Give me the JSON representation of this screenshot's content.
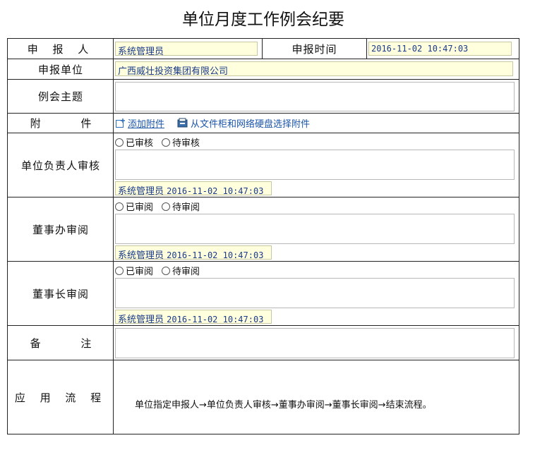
{
  "title": "单位月度工作例会纪要",
  "labels": {
    "reporter": "申 报 人",
    "report_time": "申报时间",
    "report_unit": "申报单位",
    "meeting_topic": "例会主题",
    "attachment": "附 件",
    "unit_head_review": "单位负责人审核",
    "board_office_review": "董事办审阅",
    "chairman_review": "董事长审阅",
    "remarks": "备 注",
    "workflow": "应 用 流 程"
  },
  "values": {
    "reporter": "系统管理员",
    "report_time": "2016-11-02 10:47:03",
    "report_unit": "广西威壮投资集团有限公司"
  },
  "attachment": {
    "add_label": "添加附件",
    "select_label": "从文件柜和网络硬盘选择附件"
  },
  "reviews": [
    {
      "opt_a": "已审核",
      "opt_b": "待审核",
      "signer": "系统管理员",
      "time": "2016-11-02 10:47:03"
    },
    {
      "opt_a": "已审阅",
      "opt_b": "待审阅",
      "signer": "系统管理员",
      "time": "2016-11-02 10:47:03"
    },
    {
      "opt_a": "已审阅",
      "opt_b": "待审阅",
      "signer": "系统管理员",
      "time": "2016-11-02 10:47:03"
    }
  ],
  "workflow_text": "单位指定申报人→单位负责人审核→董事办审阅→董事长审阅→结束流程。",
  "colors": {
    "field_bg": "#ffffdd",
    "value_text": "#1a3a8a",
    "link": "#1a55a8",
    "border": "#222222"
  },
  "icons": {
    "add": "add-attachment-icon",
    "select": "file-cabinet-icon"
  }
}
